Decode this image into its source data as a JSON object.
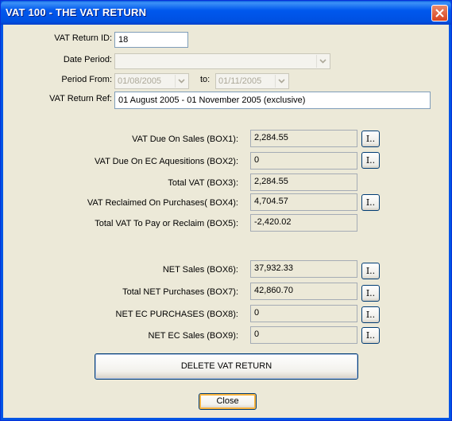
{
  "window": {
    "title": "VAT 100 - THE VAT RETURN"
  },
  "header": {
    "return_id_label": "VAT Return ID:",
    "return_id_value": "18",
    "date_period_label": "Date Period:",
    "date_period_value": "",
    "period_from_label": "Period From:",
    "period_from_value": "01/08/2005",
    "to_label": "to:",
    "period_to_value": "01/11/2005",
    "return_ref_label": "VAT Return Ref:",
    "return_ref_value": "01 August 2005 - 01 November 2005 (exclusive)"
  },
  "boxes": {
    "box1": {
      "label": "VAT Due On Sales (BOX1):",
      "value": "2,284.55",
      "button": "I.."
    },
    "box2": {
      "label": "VAT Due On EC Aquesitions (BOX2):",
      "value": "0",
      "button": "I.."
    },
    "box3": {
      "label": "Total VAT (BOX3):",
      "value": "2,284.55"
    },
    "box4": {
      "label": "VAT Reclaimed On Purchases( BOX4):",
      "value": "4,704.57",
      "button": "I.."
    },
    "box5": {
      "label": "Total VAT To Pay or Reclaim (BOX5):",
      "value": "-2,420.02"
    },
    "box6": {
      "label": "NET Sales (BOX6):",
      "value": "37,932.33",
      "button": "I.."
    },
    "box7": {
      "label": "Total NET Purchases (BOX7):",
      "value": "42,860.70",
      "button": "I.."
    },
    "box8": {
      "label": "NET EC PURCHASES (BOX8):",
      "value": "0",
      "button": "I.."
    },
    "box9": {
      "label": "NET EC Sales (BOX9):",
      "value": "0",
      "button": "I.."
    }
  },
  "actions": {
    "delete_label": "DELETE VAT RETURN",
    "close_label": "Close"
  },
  "icons": {
    "window_close": "close-icon",
    "dropdown": "chevron-down-icon"
  },
  "colors": {
    "titlebar": "#0058ee",
    "client_bg": "#ece9d8",
    "close_button": "#d9431f"
  }
}
